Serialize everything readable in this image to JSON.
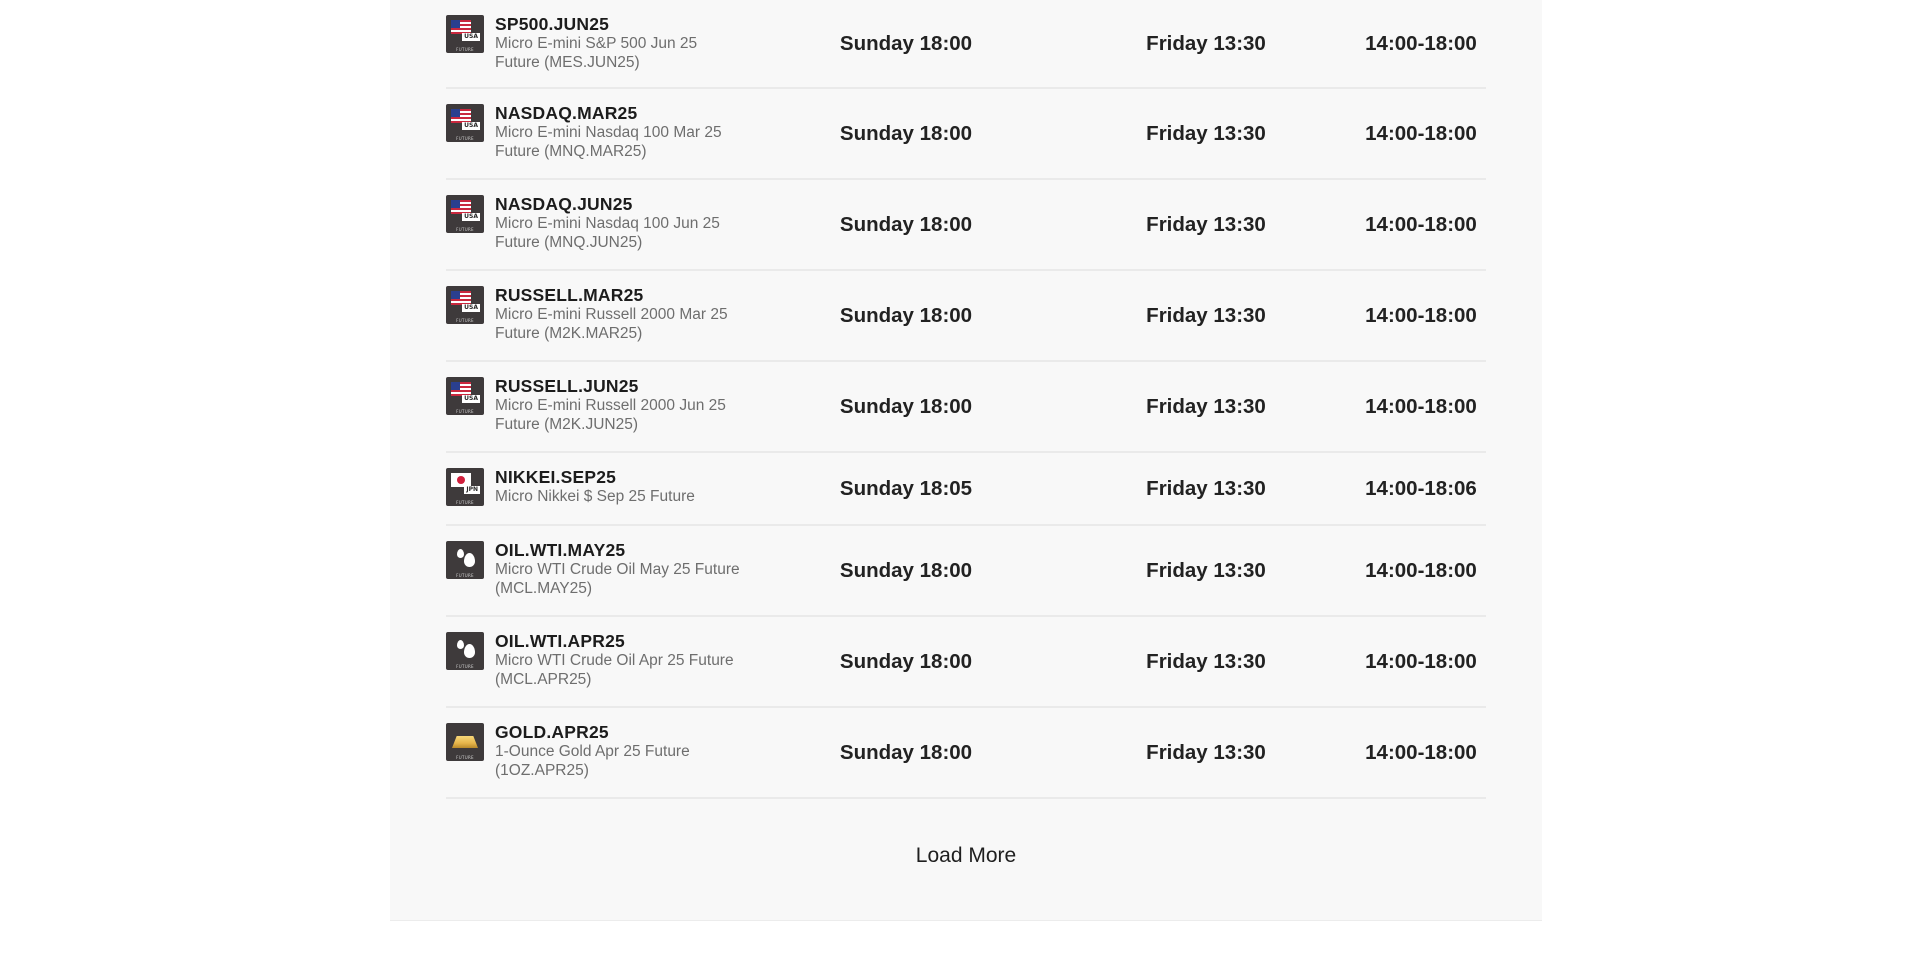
{
  "rows": [
    {
      "symbol": "SP500.JUN25",
      "desc": "Micro E-mini S&P 500 Jun 25 Future (MES.JUN25)",
      "icon": "us-flag-future-icon",
      "open": "Sunday 18:00",
      "close": "Friday 13:30",
      "break": "14:00-18:00"
    },
    {
      "symbol": "NASDAQ.MAR25",
      "desc": "Micro E-mini Nasdaq 100 Mar 25 Future (MNQ.MAR25)",
      "icon": "us-flag-future-icon",
      "open": "Sunday 18:00",
      "close": "Friday 13:30",
      "break": "14:00-18:00"
    },
    {
      "symbol": "NASDAQ.JUN25",
      "desc": "Micro E-mini Nasdaq 100 Jun 25 Future (MNQ.JUN25)",
      "icon": "us-flag-future-icon",
      "open": "Sunday 18:00",
      "close": "Friday 13:30",
      "break": "14:00-18:00"
    },
    {
      "symbol": "RUSSELL.MAR25",
      "desc": "Micro E-mini Russell 2000 Mar 25 Future (M2K.MAR25)",
      "icon": "us-flag-future-icon",
      "open": "Sunday 18:00",
      "close": "Friday 13:30",
      "break": "14:00-18:00"
    },
    {
      "symbol": "RUSSELL.JUN25",
      "desc": "Micro E-mini Russell 2000 Jun 25 Future (M2K.JUN25)",
      "icon": "us-flag-future-icon",
      "open": "Sunday 18:00",
      "close": "Friday 13:30",
      "break": "14:00-18:00"
    },
    {
      "symbol": "NIKKEI.SEP25",
      "desc": "Micro Nikkei $ Sep 25 Future",
      "icon": "jp-flag-future-icon",
      "open": "Sunday 18:05",
      "close": "Friday 13:30",
      "break": "14:00-18:06"
    },
    {
      "symbol": "OIL.WTI.MAY25",
      "desc": "Micro WTI Crude Oil May 25 Future (MCL.MAY25)",
      "icon": "oil-drop-future-icon",
      "open": "Sunday 18:00",
      "close": "Friday 13:30",
      "break": "14:00-18:00"
    },
    {
      "symbol": "OIL.WTI.APR25",
      "desc": "Micro WTI Crude Oil Apr 25 Future (MCL.APR25)",
      "icon": "oil-drop-future-icon",
      "open": "Sunday 18:00",
      "close": "Friday 13:30",
      "break": "14:00-18:00"
    },
    {
      "symbol": "GOLD.APR25",
      "desc": "1-Ounce Gold Apr 25 Future (1OZ.APR25)",
      "icon": "gold-bar-future-icon",
      "open": "Sunday 18:00",
      "close": "Friday 13:30",
      "break": "14:00-18:00"
    }
  ],
  "icon_labels": {
    "future": "FUTURE",
    "usa": "USA",
    "jpn": "JPN"
  },
  "load_more_label": "Load More",
  "colors": {
    "panel_bg": "#f8f8f8",
    "divider": "#eaeaea",
    "icon_bg": "#3e3a3b",
    "text_primary": "#1c1c1c",
    "text_secondary": "#6e6e6e"
  }
}
